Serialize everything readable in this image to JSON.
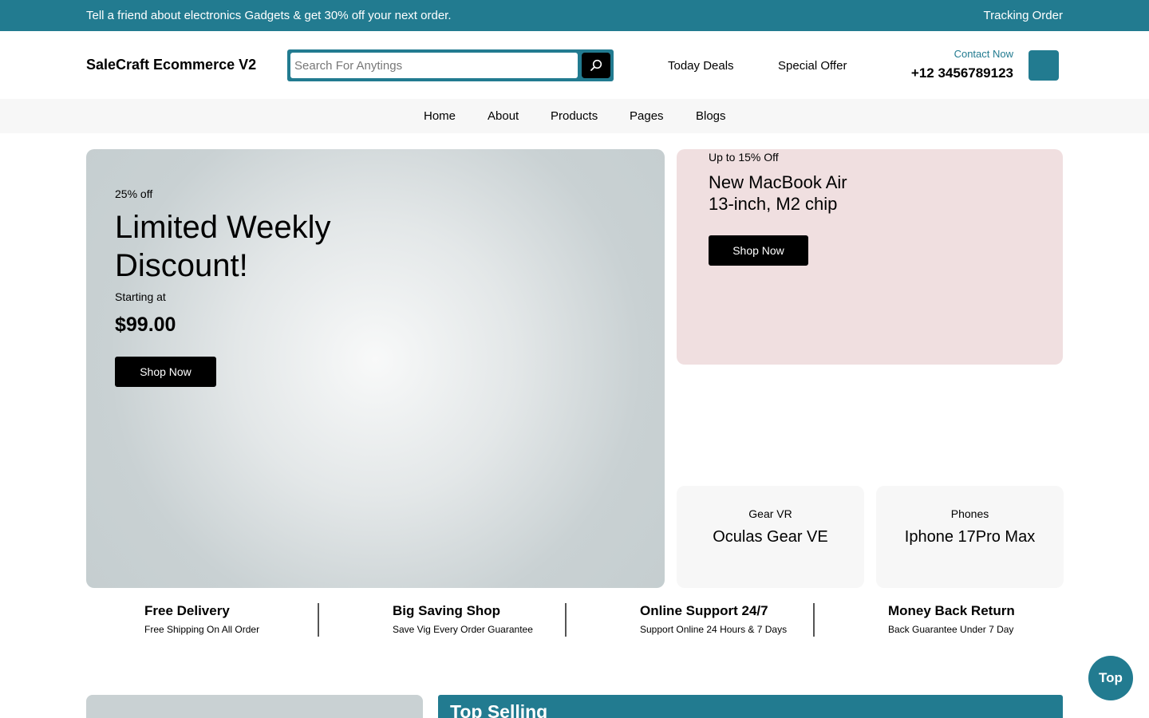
{
  "topbar": {
    "promo": "Tell a friend about electronics Gadgets & get 30% off your next order.",
    "tracking": "Tracking Order"
  },
  "header": {
    "logo": "SaleCraft Ecommerce V2",
    "search_placeholder": "Search For Anytings",
    "today_deals": "Today Deals",
    "special_offer": "Special Offer",
    "contact_label": "Contact Now",
    "contact_phone": "+12 3456789123"
  },
  "nav": {
    "items": [
      "Home",
      "About",
      "Products",
      "Pages",
      "Blogs"
    ]
  },
  "hero": {
    "discount": "25% off",
    "title": "Limited Weekly Discount!",
    "starting": "Starting at",
    "price": "$99.00",
    "button": "Shop Now"
  },
  "promo_card": {
    "upto": "Up to 15% Off",
    "title_line1": "New MacBook Air",
    "title_line2": "13-inch, M2 chip",
    "button": "Shop Now"
  },
  "small_cards": [
    {
      "category": "Gear VR",
      "product": "Oculas Gear VE"
    },
    {
      "category": "Phones",
      "product": "Iphone 17Pro Max"
    }
  ],
  "features": [
    {
      "title": "Free Delivery",
      "subtitle": "Free Shipping On All Order"
    },
    {
      "title": "Big Saving Shop",
      "subtitle": "Save Vig Every Order Guarantee"
    },
    {
      "title": "Online Support 24/7",
      "subtitle": "Support Online 24 Hours & 7 Days"
    },
    {
      "title": "Money Back Return",
      "subtitle": "Back Guarantee Under 7 Day"
    }
  ],
  "top_selling": "Top Selling",
  "top_button": "Top",
  "colors": {
    "accent": "#227b90",
    "promo_bg": "#f0dfe0",
    "hero_bg": "#c9d1d3"
  }
}
